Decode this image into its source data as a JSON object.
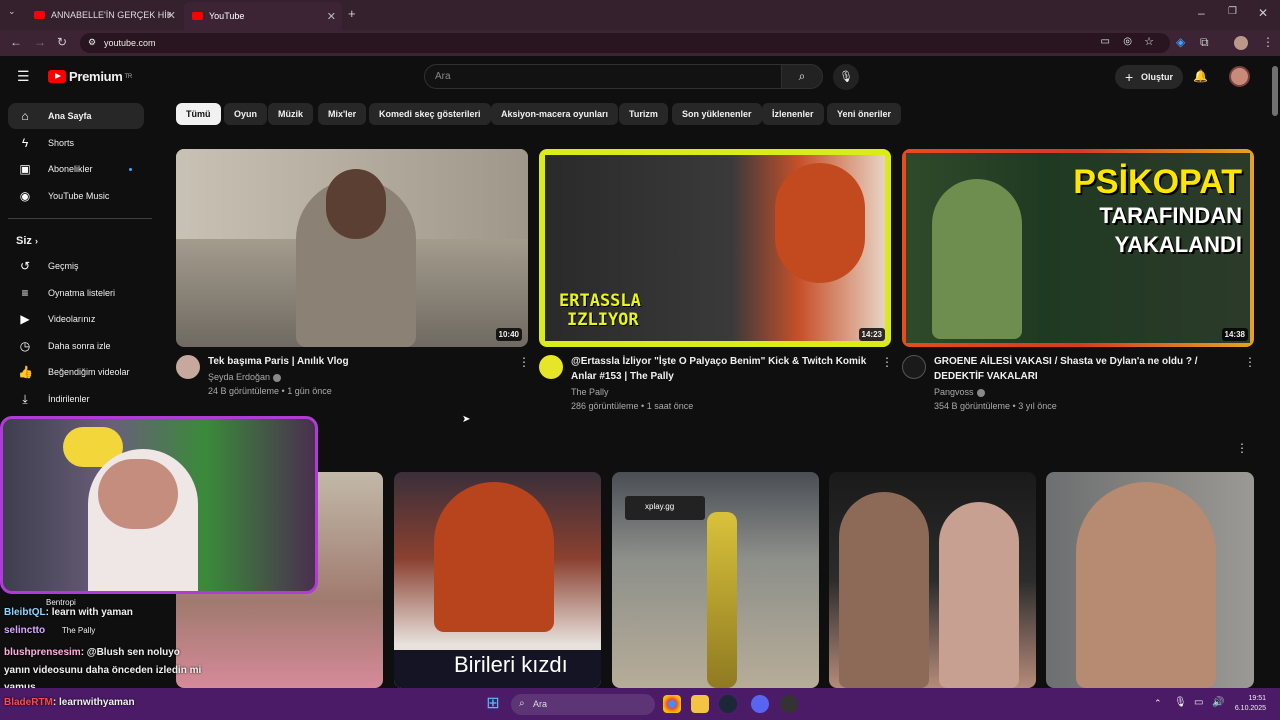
{
  "browser": {
    "tabs": [
      {
        "label": "ANNABELLE'İN GERÇEK HİKAYESİ"
      },
      {
        "label": "YouTube"
      }
    ],
    "url": "youtube.com"
  },
  "header": {
    "logo": "Premium",
    "logo_sup": "TR",
    "search_placeholder": "Ara",
    "create_label": "Oluştur"
  },
  "sidebar": {
    "main": [
      {
        "label": "Ana Sayfa",
        "icon": "home-icon"
      },
      {
        "label": "Shorts",
        "icon": "shorts-icon"
      },
      {
        "label": "Abonelikler",
        "icon": "subscriptions-icon"
      },
      {
        "label": "YouTube Music",
        "icon": "music-icon"
      }
    ],
    "you_heading": "Siz",
    "you": [
      {
        "label": "Geçmiş",
        "icon": "history-icon"
      },
      {
        "label": "Oynatma listeleri",
        "icon": "playlist-icon"
      },
      {
        "label": "Videolarınız",
        "icon": "your-videos-icon"
      },
      {
        "label": "Daha sonra izle",
        "icon": "watch-later-icon"
      },
      {
        "label": "Beğendiğim videolar",
        "icon": "like-icon"
      },
      {
        "label": "İndirilenler",
        "icon": "download-icon"
      }
    ]
  },
  "chips": [
    "Tümü",
    "Oyun",
    "Müzik",
    "Mix'ler",
    "Komedi skeç gösterileri",
    "Aksiyon-macera oyunları",
    "Turizm",
    "Son yüklenenler",
    "İzlenenler",
    "Yeni öneriler"
  ],
  "videos": [
    {
      "title_line1": "Tek başıma Paris | Anılık Vlog",
      "title_line2": "",
      "channel": "Şeyda Erdoğan",
      "meta": "24 B görüntüleme • 1 gün önce",
      "duration": "10:40"
    },
    {
      "title_line1": "@Ertassla İzliyor \"İşte O Palyaço Benim\" Kick & Twitch Komik",
      "title_line2": "Anlar #153 | The Pally",
      "channel": "The Pally",
      "meta": "286 görüntüleme • 1 saat önce",
      "duration": "14:23",
      "thumb_text1": "ERTASSLA",
      "thumb_text2": "IZLIYOR"
    },
    {
      "title_line1": "GROENE AİLESİ VAKASI / Shasta ve Dylan'a ne oldu ? /",
      "title_line2": "DEDEKTİF VAKALARI",
      "channel": "Pangvoss",
      "meta": "354 B görüntüleme • 3 yıl önce",
      "duration": "14:38",
      "thumb_text1": "PSİKOPAT",
      "thumb_text2": "TARAFINDAN",
      "thumb_text3": "YAKALANDI"
    }
  ],
  "shorts_captions": {
    "caption": "Birileri kızdı",
    "badge": "xplay.gg"
  },
  "chat": [
    {
      "user": "Bentropi",
      "text": ""
    },
    {
      "user": "BleibtQL",
      "text": ": learn with yaman"
    },
    {
      "user": "selinctto",
      "text": "The Pally"
    },
    {
      "user": "blushprensesim",
      "text": ": @Blush sen noluyo"
    },
    {
      "user": "",
      "text": "yanın videosunu daha önceden izledin mi"
    },
    {
      "user": "",
      "text": "yamus"
    },
    {
      "user": "BladeRTM",
      "text": ": learnwithyaman"
    }
  ],
  "taskbar": {
    "search": "Ara",
    "time": "19:51",
    "date": "6.10.2025"
  },
  "colors": {
    "accent": "#ff0000",
    "taskbar": "#4b1b67",
    "overlay_border": "#b13bd8"
  }
}
